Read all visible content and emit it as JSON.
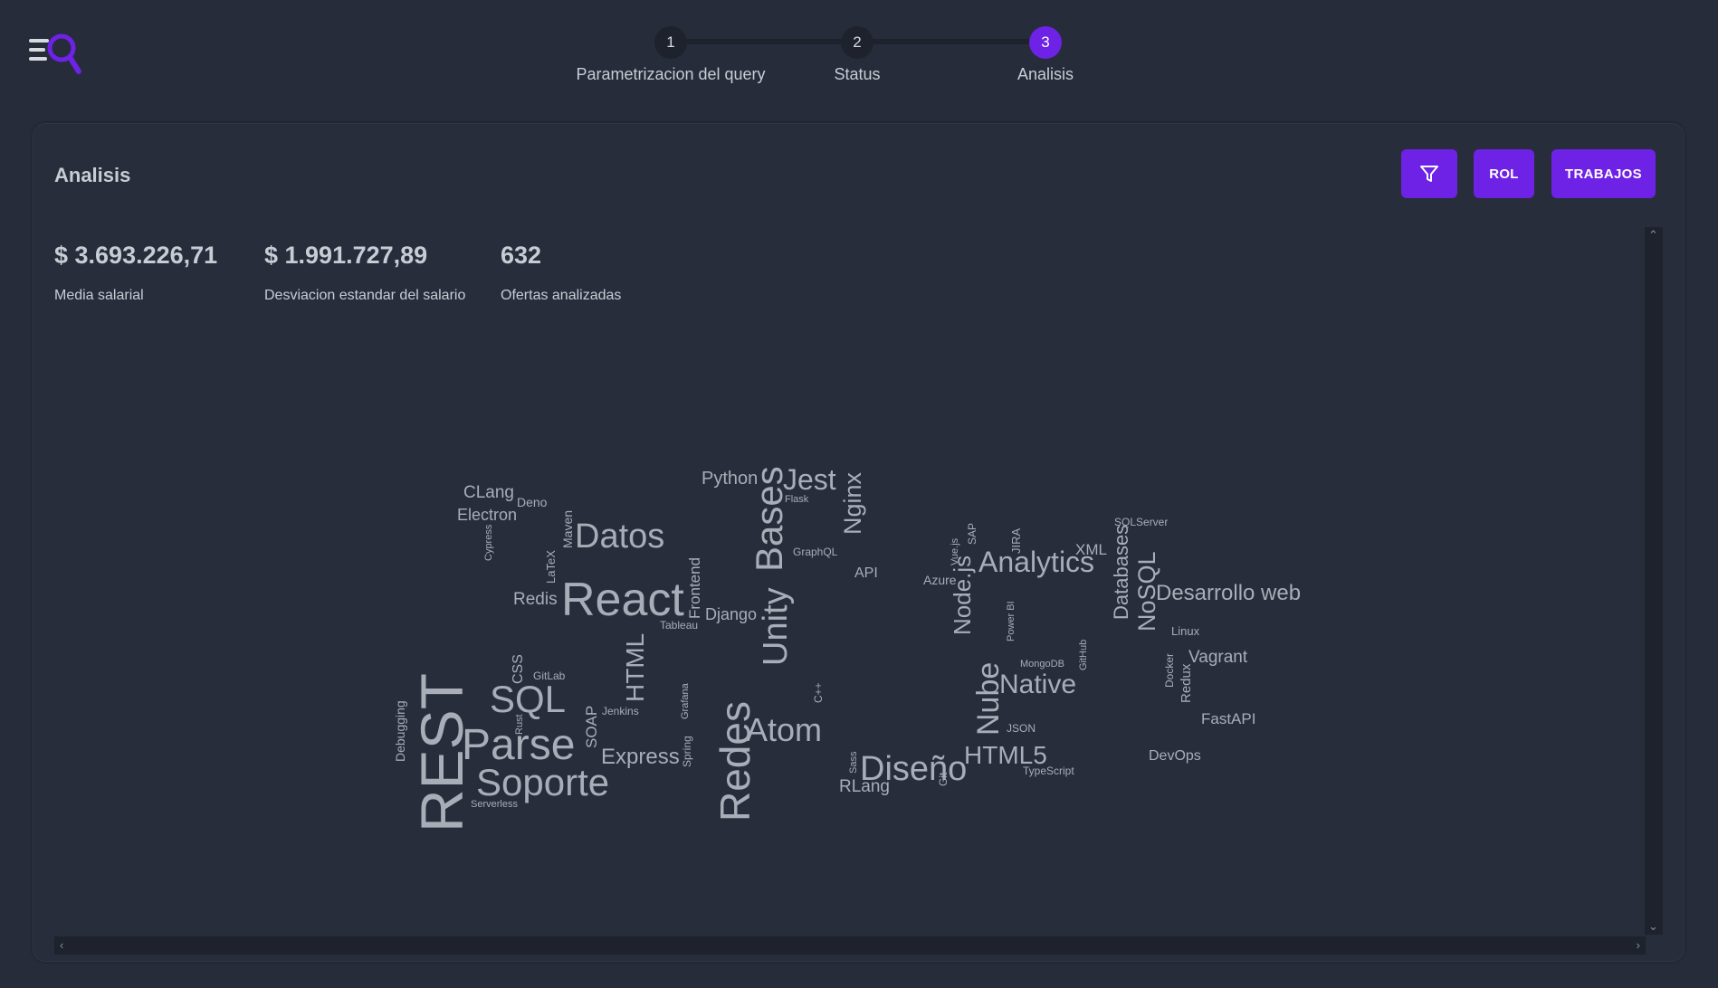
{
  "stepper": {
    "steps": [
      {
        "number": "1",
        "label": "Parametrizacion del query"
      },
      {
        "number": "2",
        "label": "Status"
      },
      {
        "number": "3",
        "label": "Analisis"
      }
    ]
  },
  "card": {
    "title": "Analisis",
    "buttons": {
      "filter_icon": "filter-icon",
      "rol": "ROL",
      "trabajos": "TRABAJOS"
    },
    "stats": [
      {
        "value": "$ 3.693.226,71",
        "label": "Media salarial"
      },
      {
        "value": "$ 1.991.727,89",
        "label": "Desviacion estandar del salario"
      },
      {
        "value": "632",
        "label": "Ofertas analizadas"
      }
    ]
  },
  "colors": {
    "accent": "#6d22e6",
    "background": "#272c3a",
    "card": "#282d3b",
    "text": "#c8ccd4",
    "cloud_text": "#a8adb8"
  },
  "word_cloud": {
    "words": [
      "CLang",
      "Deno",
      "Electron",
      "Cypress",
      "Maven",
      "LaTeX",
      "Datos",
      "Python",
      "Jest",
      "Flask",
      "Bases",
      "Nginx",
      "GraphQL",
      "API",
      "Redis",
      "React",
      "Frontend",
      "Django",
      "Tableau",
      "Unity",
      "Vue.js",
      "SAP",
      "JIRA",
      "XML",
      "SQLServer",
      "Analytics",
      "Databases",
      "NoSQL",
      "Desarrollo web",
      "Azure",
      "Node.js",
      "Power BI",
      "Linux",
      "CSS",
      "GitLab",
      "SQL",
      "HTML",
      "Jenkins",
      "Grafana",
      "C++",
      "MongoDB",
      "GitHub",
      "Docker",
      "Redux",
      "Vagrant",
      "Debugging",
      "REST",
      "Rust",
      "SOAP",
      "Parse",
      "Express",
      "Spring",
      "Redes",
      "Atom",
      "Nube",
      "Native",
      "JSON",
      "FastAPI",
      "Git",
      "Soporte",
      "Serverless",
      "Sass",
      "Diseño",
      "RLang",
      "HTML5",
      "TypeScript",
      "DevOps"
    ]
  }
}
